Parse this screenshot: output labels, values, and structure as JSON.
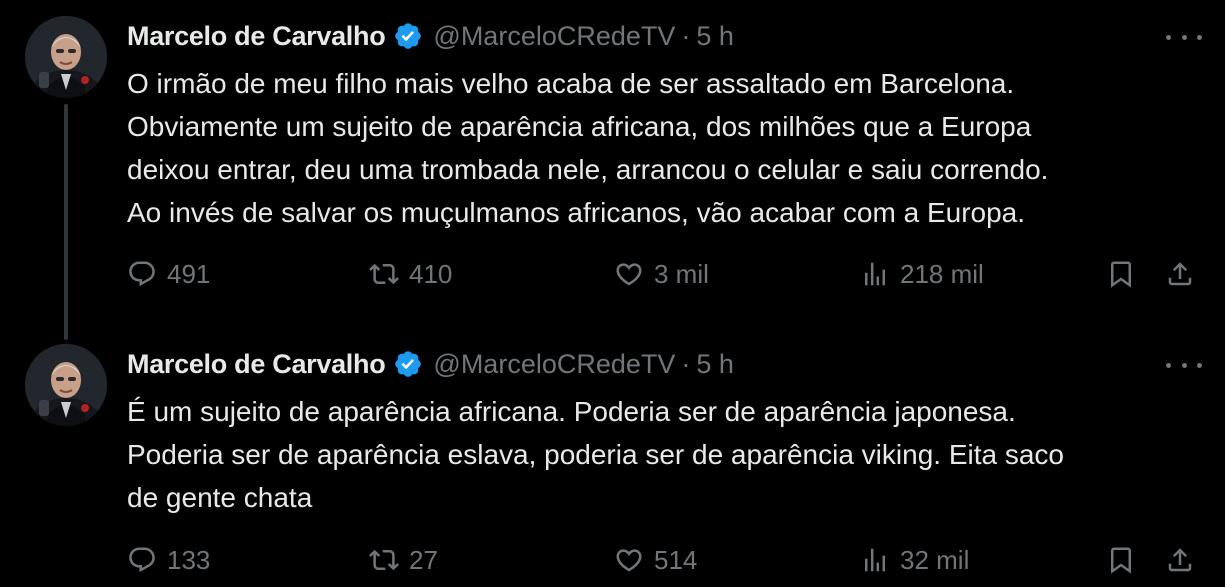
{
  "colors": {
    "background": "#000000",
    "text_primary": "#e7e9ea",
    "text_secondary": "#71767b",
    "verified_blue": "#1d9bf0",
    "thread_line": "#333639"
  },
  "tweets": [
    {
      "author": {
        "display_name": "Marcelo de Carvalho",
        "handle": "@MarceloCRedeTV",
        "verified": true,
        "verified_icon": "verified-badge-icon"
      },
      "separator": "·",
      "time": "5 h",
      "text_lines": [
        "O irmão de meu filho mais velho acaba de ser assaltado em Barcelona.",
        "Obviamente um sujeito de aparência africana, dos milhões que a Europa",
        "deixou entrar, deu uma trombada nele, arrancou o celular e saiu correndo.",
        "Ao invés de salvar os muçulmanos africanos, vão acabar com a Europa."
      ],
      "stats": {
        "replies": "491",
        "reposts": "410",
        "likes": "3 mil",
        "views": "218 mil"
      }
    },
    {
      "author": {
        "display_name": "Marcelo de Carvalho",
        "handle": "@MarceloCRedeTV",
        "verified": true,
        "verified_icon": "verified-badge-icon"
      },
      "separator": "·",
      "time": "5 h",
      "text_lines": [
        "É um sujeito de aparência africana. Poderia ser de aparência japonesa.",
        "Poderia ser de aparência eslava, poderia ser de aparência viking. Eita saco",
        "de gente chata"
      ],
      "stats": {
        "replies": "133",
        "reposts": "27",
        "likes": "514",
        "views": "32 mil"
      }
    }
  ],
  "icons": {
    "reply": "reply-icon",
    "repost": "repost-icon",
    "like": "heart-icon",
    "views": "views-chart-icon",
    "bookmark": "bookmark-icon",
    "share": "share-icon",
    "more": "more-dots-icon"
  }
}
